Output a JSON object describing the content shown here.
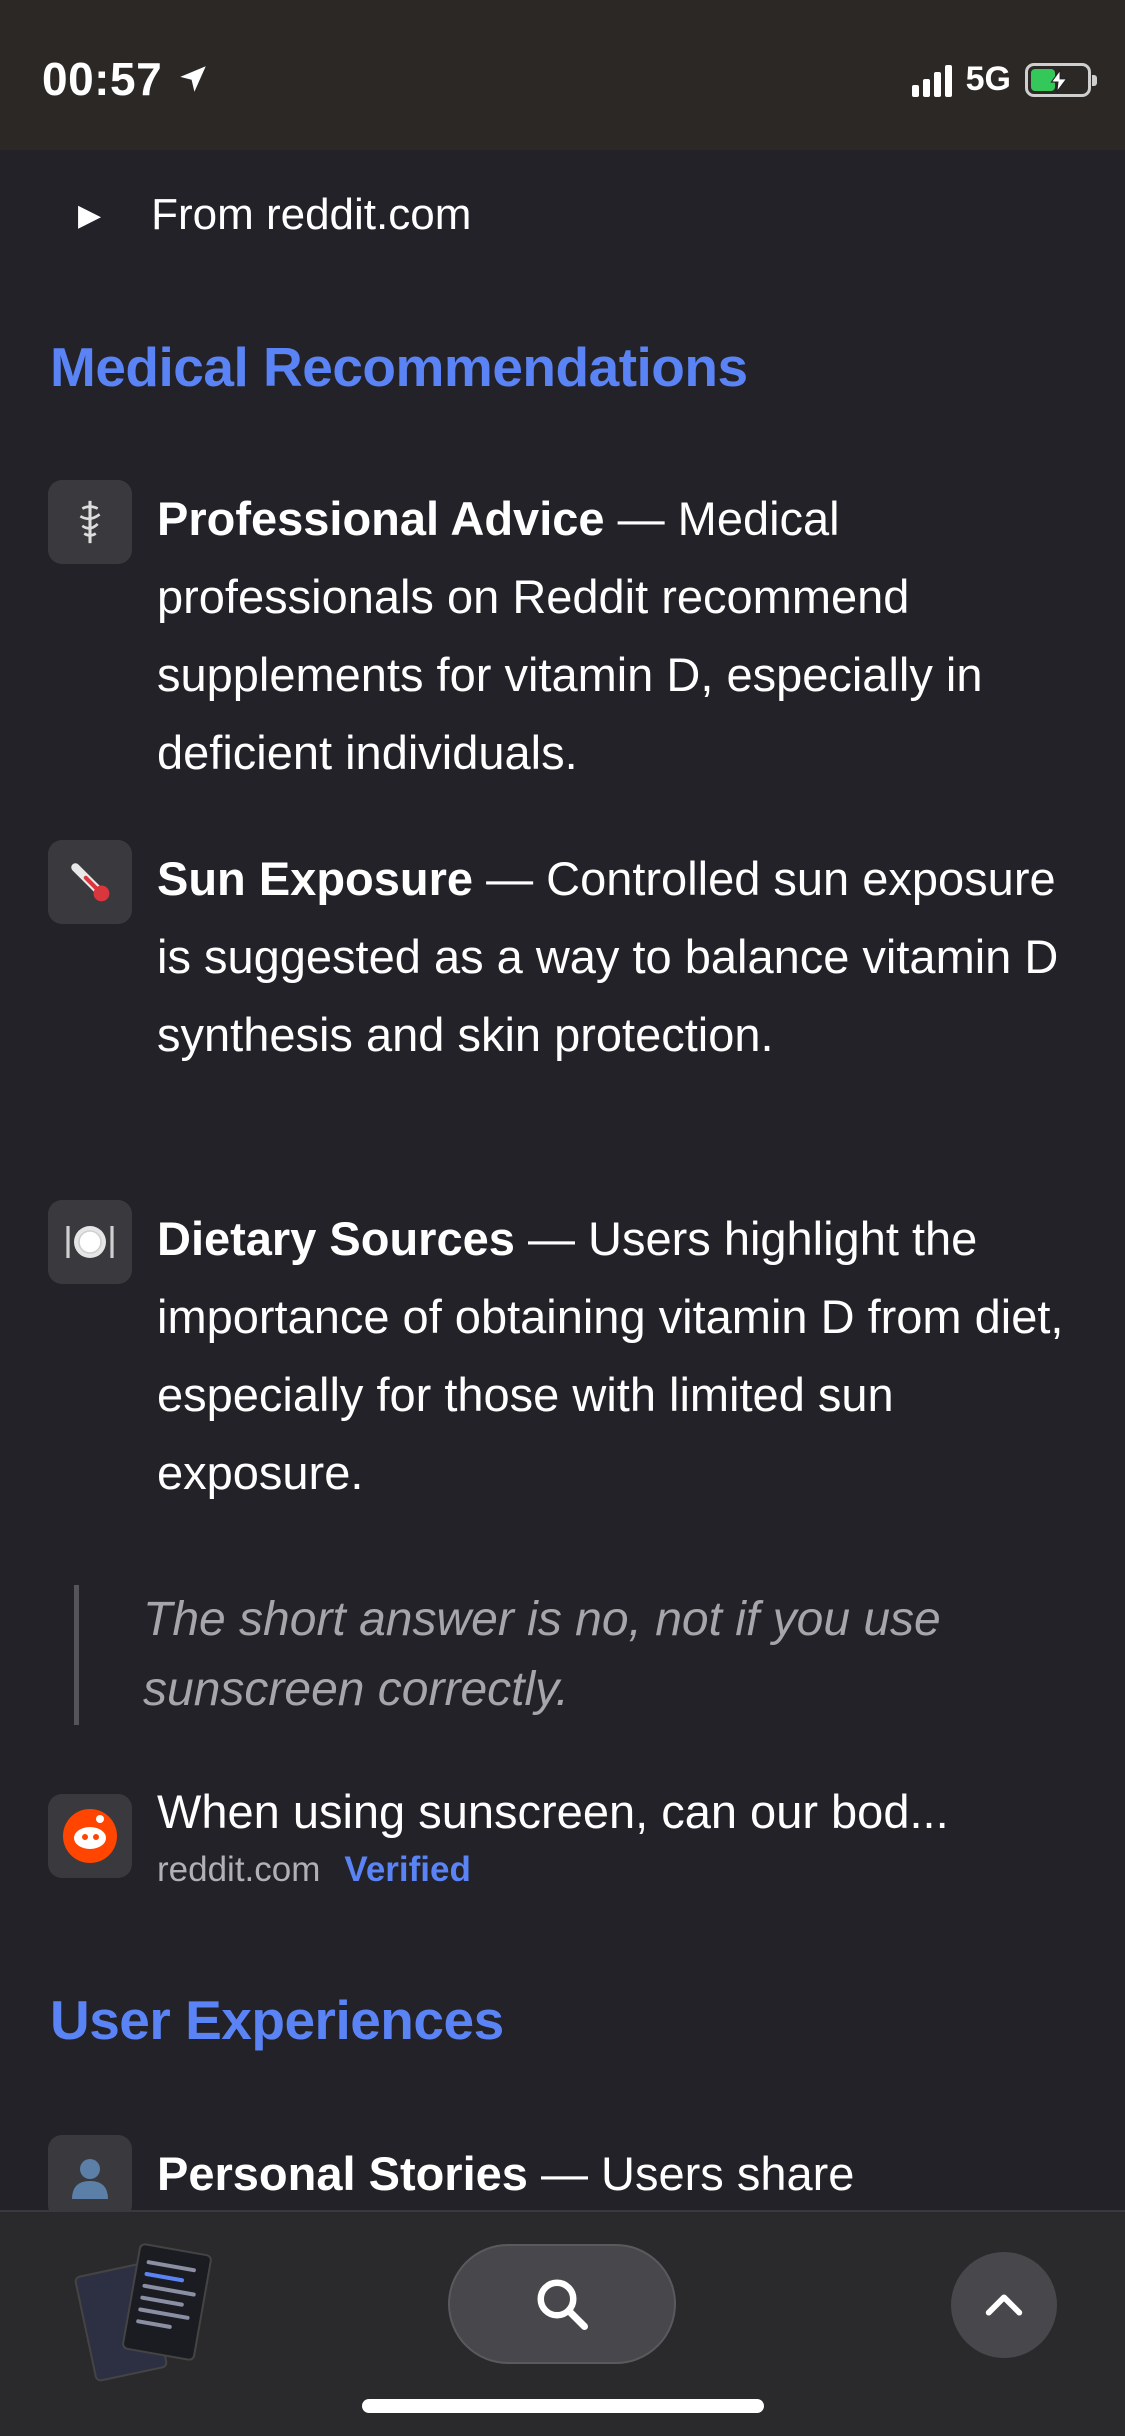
{
  "status_bar": {
    "time": "00:57",
    "network": "5G",
    "icons": [
      "location-arrow-icon",
      "cellular-signal-icon",
      "battery-charging-icon"
    ]
  },
  "source_row": {
    "label": "From reddit.com"
  },
  "sections": {
    "medical": {
      "heading": "Medical Recommendations",
      "items": [
        {
          "icon": "caduceus-icon",
          "title": "Professional Advice",
          "text": " — Medical professionals on Reddit recommend supplements for vitamin D, especially in deficient individuals."
        },
        {
          "icon": "thermometer-icon",
          "title": "Sun Exposure",
          "text": " — Controlled sun exposure is suggested as a way to balance vitamin D synthesis and skin protection."
        },
        {
          "icon": "plate-icon",
          "title": "Dietary Sources",
          "text": " — Users highlight the importance of obtaining vitamin D from diet, especially for those with limited sun exposure."
        }
      ]
    },
    "quote": {
      "text": "The short answer is no, not if you use sunscreen correctly."
    },
    "link_card": {
      "title": "When using sunscreen, can our bod...",
      "domain": "reddit.com",
      "badge": "Verified"
    },
    "user": {
      "heading": "User Experiences",
      "items": [
        {
          "icon": "person-icon",
          "title": "Personal Stories",
          "text": " — Users share"
        }
      ]
    }
  },
  "toolbar": {
    "tabs_icon": "tabs-thumbnail-icon",
    "search_icon": "search-icon",
    "scroll_up_icon": "chevron-up-icon"
  },
  "colors": {
    "background": "#232228",
    "accent": "#5a84f5",
    "quote_text": "#a5a5aa",
    "reddit": "#ff4500"
  }
}
